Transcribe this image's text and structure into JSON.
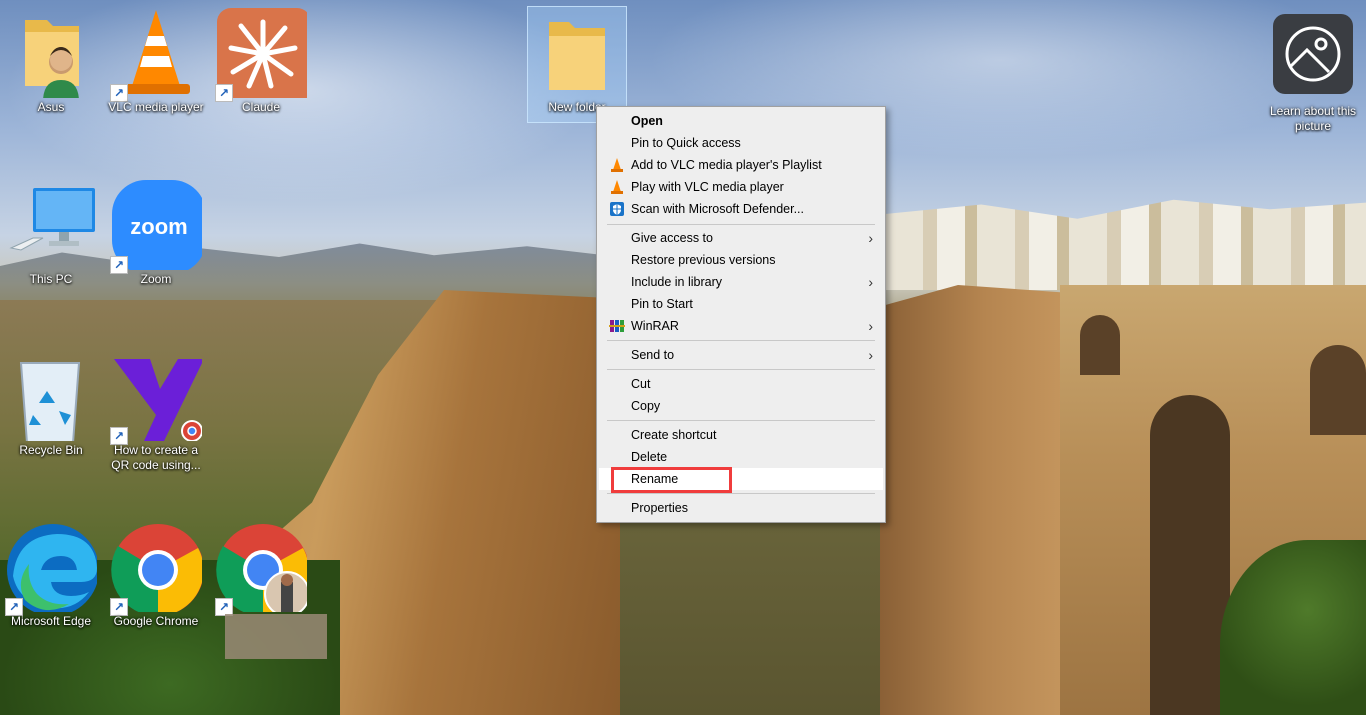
{
  "desktop_icons": [
    {
      "name": "asus",
      "label": "Asus"
    },
    {
      "name": "vlc",
      "label": "VLC media player"
    },
    {
      "name": "claude",
      "label": "Claude"
    },
    {
      "name": "new-folder",
      "label": "New folder"
    },
    {
      "name": "this-pc",
      "label": "This PC"
    },
    {
      "name": "zoom",
      "label": "Zoom",
      "logo_text": "zoom"
    },
    {
      "name": "recycle-bin",
      "label": "Recycle Bin"
    },
    {
      "name": "qr-shortcut",
      "label": "How to create a QR code using..."
    },
    {
      "name": "edge",
      "label": "Microsoft Edge"
    },
    {
      "name": "chrome",
      "label": "Google Chrome"
    },
    {
      "name": "chrome-profile",
      "label": ""
    }
  ],
  "learn_about": {
    "label": "Learn about this picture"
  },
  "context_menu": {
    "open": "Open",
    "pin_quick_access": "Pin to Quick access",
    "add_vlc_playlist": "Add to VLC media player's Playlist",
    "play_vlc": "Play with VLC media player",
    "scan_defender": "Scan with Microsoft Defender...",
    "give_access": "Give access to",
    "restore_versions": "Restore previous versions",
    "include_library": "Include in library",
    "pin_start": "Pin to Start",
    "winrar": "WinRAR",
    "send_to": "Send to",
    "cut": "Cut",
    "copy": "Copy",
    "create_shortcut": "Create shortcut",
    "delete": "Delete",
    "rename": "Rename",
    "properties": "Properties"
  },
  "colors": {
    "highlight": "#f03c3c",
    "menu_bg": "#eeeeee",
    "claude_orange": "#d9744a",
    "zoom_blue": "#2d8cff"
  }
}
